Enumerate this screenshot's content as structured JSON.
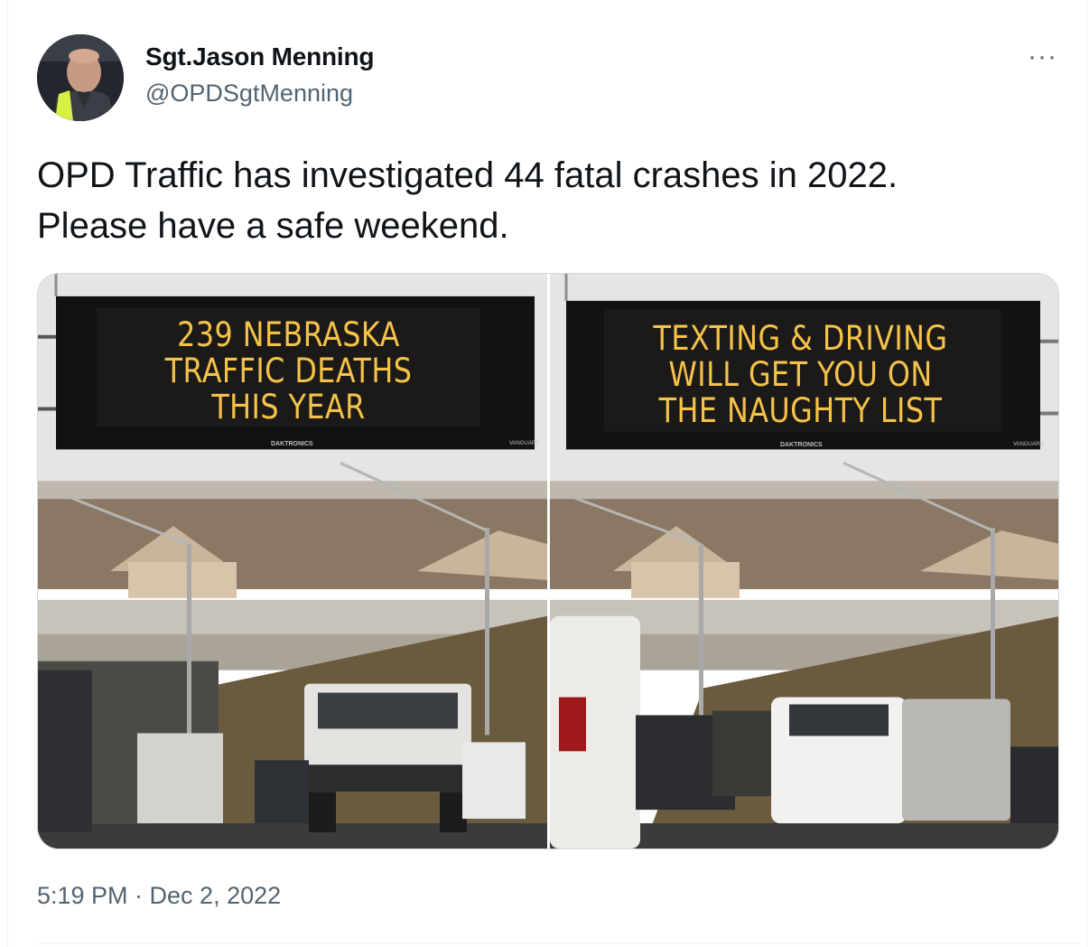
{
  "author": {
    "display_name": "Sgt.Jason Menning",
    "handle": "@OPDSgtMenning"
  },
  "more_menu_label": "···",
  "tweet": {
    "text_line1": "OPD Traffic has investigated 44 fatal crashes in 2022.",
    "text_line2": "Please have a safe weekend."
  },
  "photos": [
    {
      "sign_line1": "239 NEBRASKA",
      "sign_line2": "TRAFFIC DEATHS",
      "sign_line3": "THIS YEAR",
      "sign_brand": "DAKTRONICS",
      "sign_brand2": "VANGUARD"
    },
    {
      "sign_line1": "TEXTING & DRIVING",
      "sign_line2": "WILL GET YOU ON",
      "sign_line3": "THE NAUGHTY LIST",
      "sign_brand": "DAKTRONICS",
      "sign_brand2": "VANGUARD"
    }
  ],
  "timestamp": "5:19 PM · Dec 2, 2022",
  "colors": {
    "sign_text": "#f5c24a",
    "secondary_text": "#536471",
    "primary_text": "#0f1419"
  }
}
